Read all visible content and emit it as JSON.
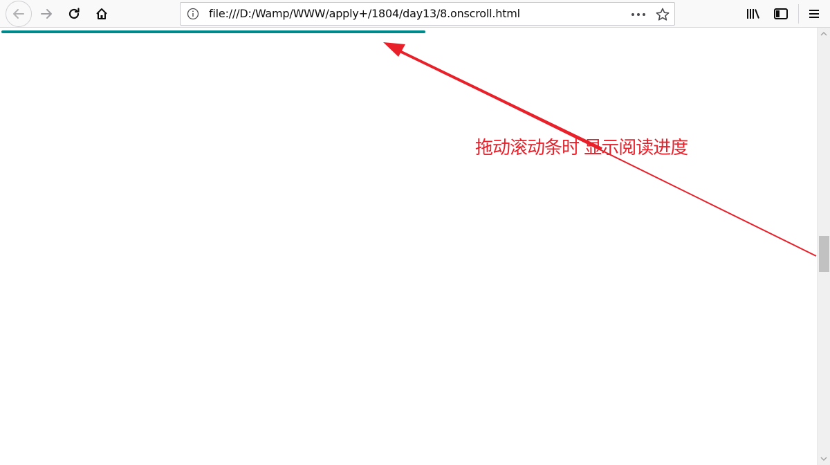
{
  "browser": {
    "url": "file:///D:/Wamp/WWW/apply+/1804/day13/8.onscroll.html",
    "icons": {
      "back": "back-arrow-icon",
      "forward": "forward-arrow-icon",
      "reload": "reload-icon",
      "home": "home-icon",
      "info": "info-icon",
      "more": "more-actions-icon",
      "bookmark": "bookmark-star-icon",
      "library": "library-icon",
      "sidebar": "sidebar-icon",
      "menu": "hamburger-menu-icon"
    }
  },
  "page": {
    "reading_progress": 0.52,
    "progress_color": "#00898b"
  },
  "annotation": {
    "text": "拖动滚动条时 显示阅读进度",
    "color": "#e8202a"
  },
  "scrollbar": {
    "position_fraction": 0.52
  }
}
